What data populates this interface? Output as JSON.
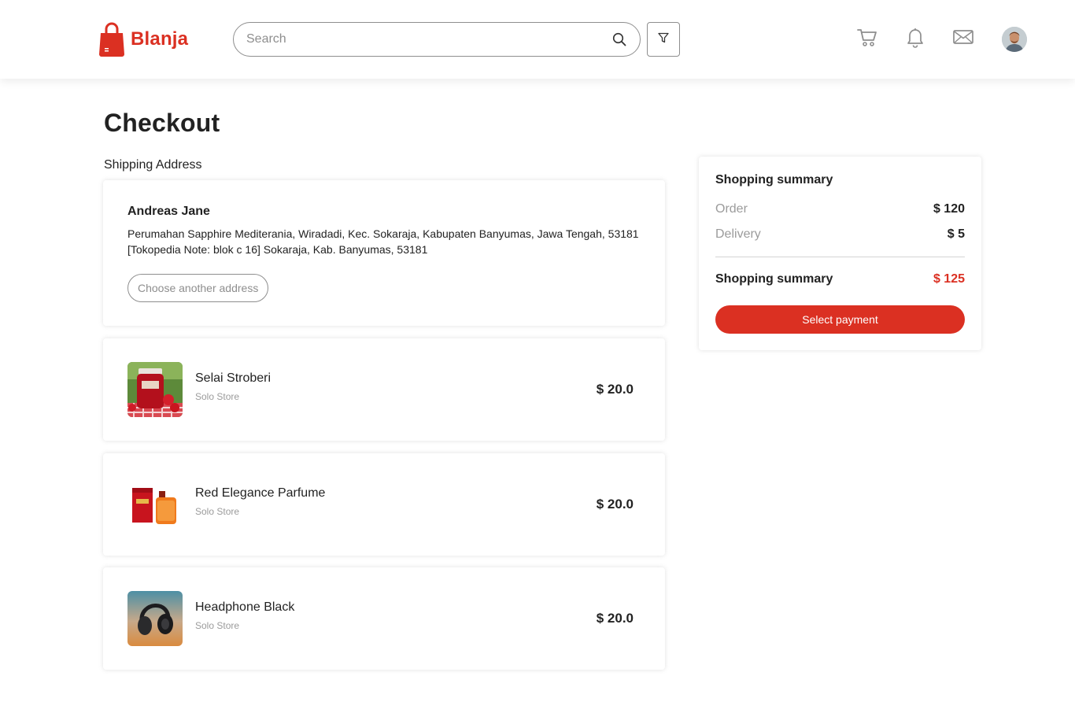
{
  "header": {
    "brand": "Blanja",
    "search": {
      "placeholder": "Search",
      "value": ""
    },
    "icons": [
      "bag-logo-icon",
      "search-icon",
      "filter-icon",
      "cart-icon",
      "bell-icon",
      "mail-icon",
      "avatar"
    ]
  },
  "colors": {
    "accent": "#DB3022",
    "muted": "#9b9b9b",
    "text": "#222222"
  },
  "page": {
    "title": "Checkout",
    "shipping_label": "Shipping Address"
  },
  "address": {
    "name": "Andreas Jane",
    "text": "Perumahan Sapphire Mediterania, Wiradadi, Kec. Sokaraja, Kabupaten Banyumas, Jawa Tengah, 53181 [Tokopedia Note: blok c 16] Sokaraja, Kab. Banyumas, 53181",
    "button_label": "Choose another address"
  },
  "items": [
    {
      "name": "Selai Stroberi",
      "store": "Solo Store",
      "price": "$ 20.0"
    },
    {
      "name": "Red Elegance Parfume",
      "store": "Solo Store",
      "price": "$ 20.0"
    },
    {
      "name": "Headphone Black",
      "store": "Solo Store",
      "price": "$ 20.0"
    }
  ],
  "summary": {
    "title": "Shopping summary",
    "order_label": "Order",
    "order_value": "$ 120",
    "delivery_label": "Delivery",
    "delivery_value": "$ 5",
    "total_label": "Shopping summary",
    "total_value": "$ 125",
    "button_label": "Select payment"
  }
}
